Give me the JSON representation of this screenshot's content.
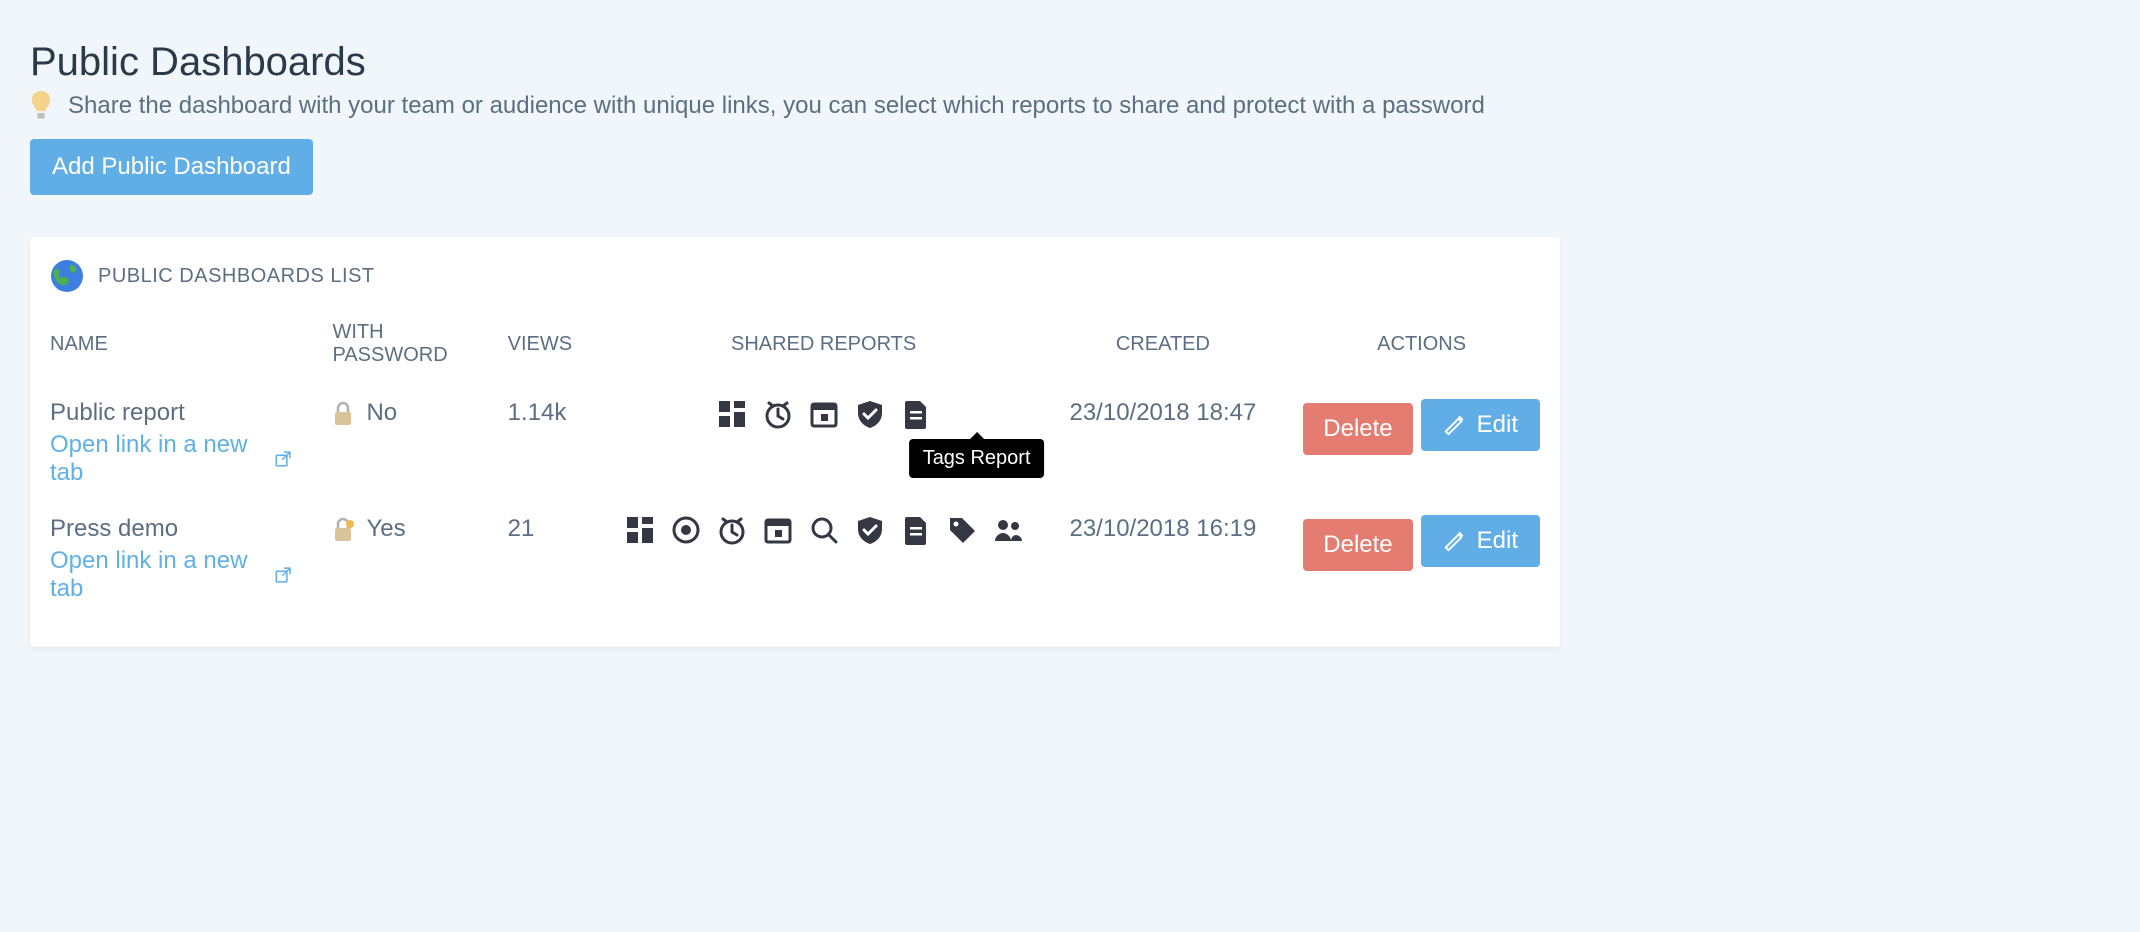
{
  "page": {
    "title": "Public Dashboards",
    "subtitle": "Share the dashboard with your team or audience with unique links, you can select which reports to share and protect with a password",
    "add_button": "Add Public Dashboard"
  },
  "card": {
    "title": "PUBLIC DASHBOARDS LIST"
  },
  "columns": {
    "name": "NAME",
    "with_password": "WITH PASSWORD",
    "views": "VIEWS",
    "shared_reports": "SHARED REPORTS",
    "created": "CREATED",
    "actions": "ACTIONS"
  },
  "labels": {
    "open_link": "Open link in a new tab",
    "delete": "Delete",
    "edit": "Edit"
  },
  "tooltip": "Tags Report",
  "rows": [
    {
      "name": "Public report",
      "with_password": "No",
      "locked": false,
      "views": "1.14k",
      "icons": [
        "dashboard",
        "clock",
        "calendar",
        "shield",
        "doc"
      ],
      "show_tooltip_after_last": true,
      "created": "23/10/2018 18:47"
    },
    {
      "name": "Press demo",
      "with_password": "Yes",
      "locked": true,
      "views": "21",
      "icons": [
        "dashboard",
        "record",
        "clock",
        "calendar",
        "search",
        "shield",
        "doc",
        "tag",
        "people"
      ],
      "show_tooltip_after_last": false,
      "created": "23/10/2018 16:19"
    }
  ]
}
